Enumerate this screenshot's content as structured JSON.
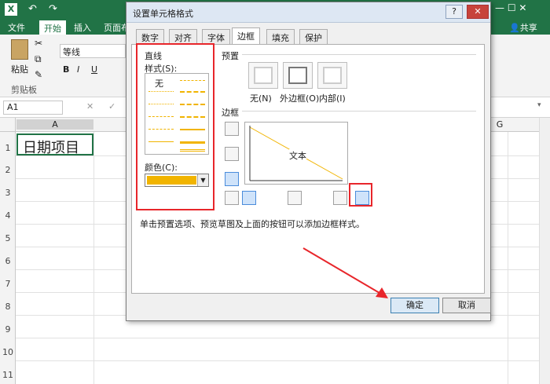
{
  "excel": {
    "tabs": [
      "文件",
      "开始",
      "插入",
      "页面布"
    ],
    "active_tab": "开始",
    "user_label": "共享",
    "clipboard": {
      "paste_label": "粘贴",
      "group_label": "剪贴板"
    },
    "font_name": "等线",
    "name_box": "A1",
    "column_a": "A",
    "column_g": "G",
    "rows": [
      "1",
      "2",
      "3",
      "4",
      "5",
      "6",
      "7",
      "8",
      "9",
      "10",
      "11"
    ],
    "cell_a1": "日期项目"
  },
  "dialog": {
    "title": "设置单元格格式",
    "tabs": [
      "数字",
      "对齐",
      "字体",
      "边框",
      "填充",
      "保护"
    ],
    "active_tab": "边框",
    "line_section": "直线",
    "style_label": "样式(S):",
    "style_none": "无",
    "color_label": "颜色(C):",
    "line_color": "#f1b400",
    "preset_label": "预置",
    "presets": [
      "无(N)",
      "外边框(O)",
      "内部(I)"
    ],
    "border_label": "边框",
    "preview_text": "文本",
    "hint": "单击预置选项、预览草图及上面的按钮可以添加边框样式。",
    "ok_label": "确定",
    "cancel_label": "取消"
  },
  "colors": {
    "excel_green": "#217346",
    "annotation_red": "#e8262b"
  }
}
